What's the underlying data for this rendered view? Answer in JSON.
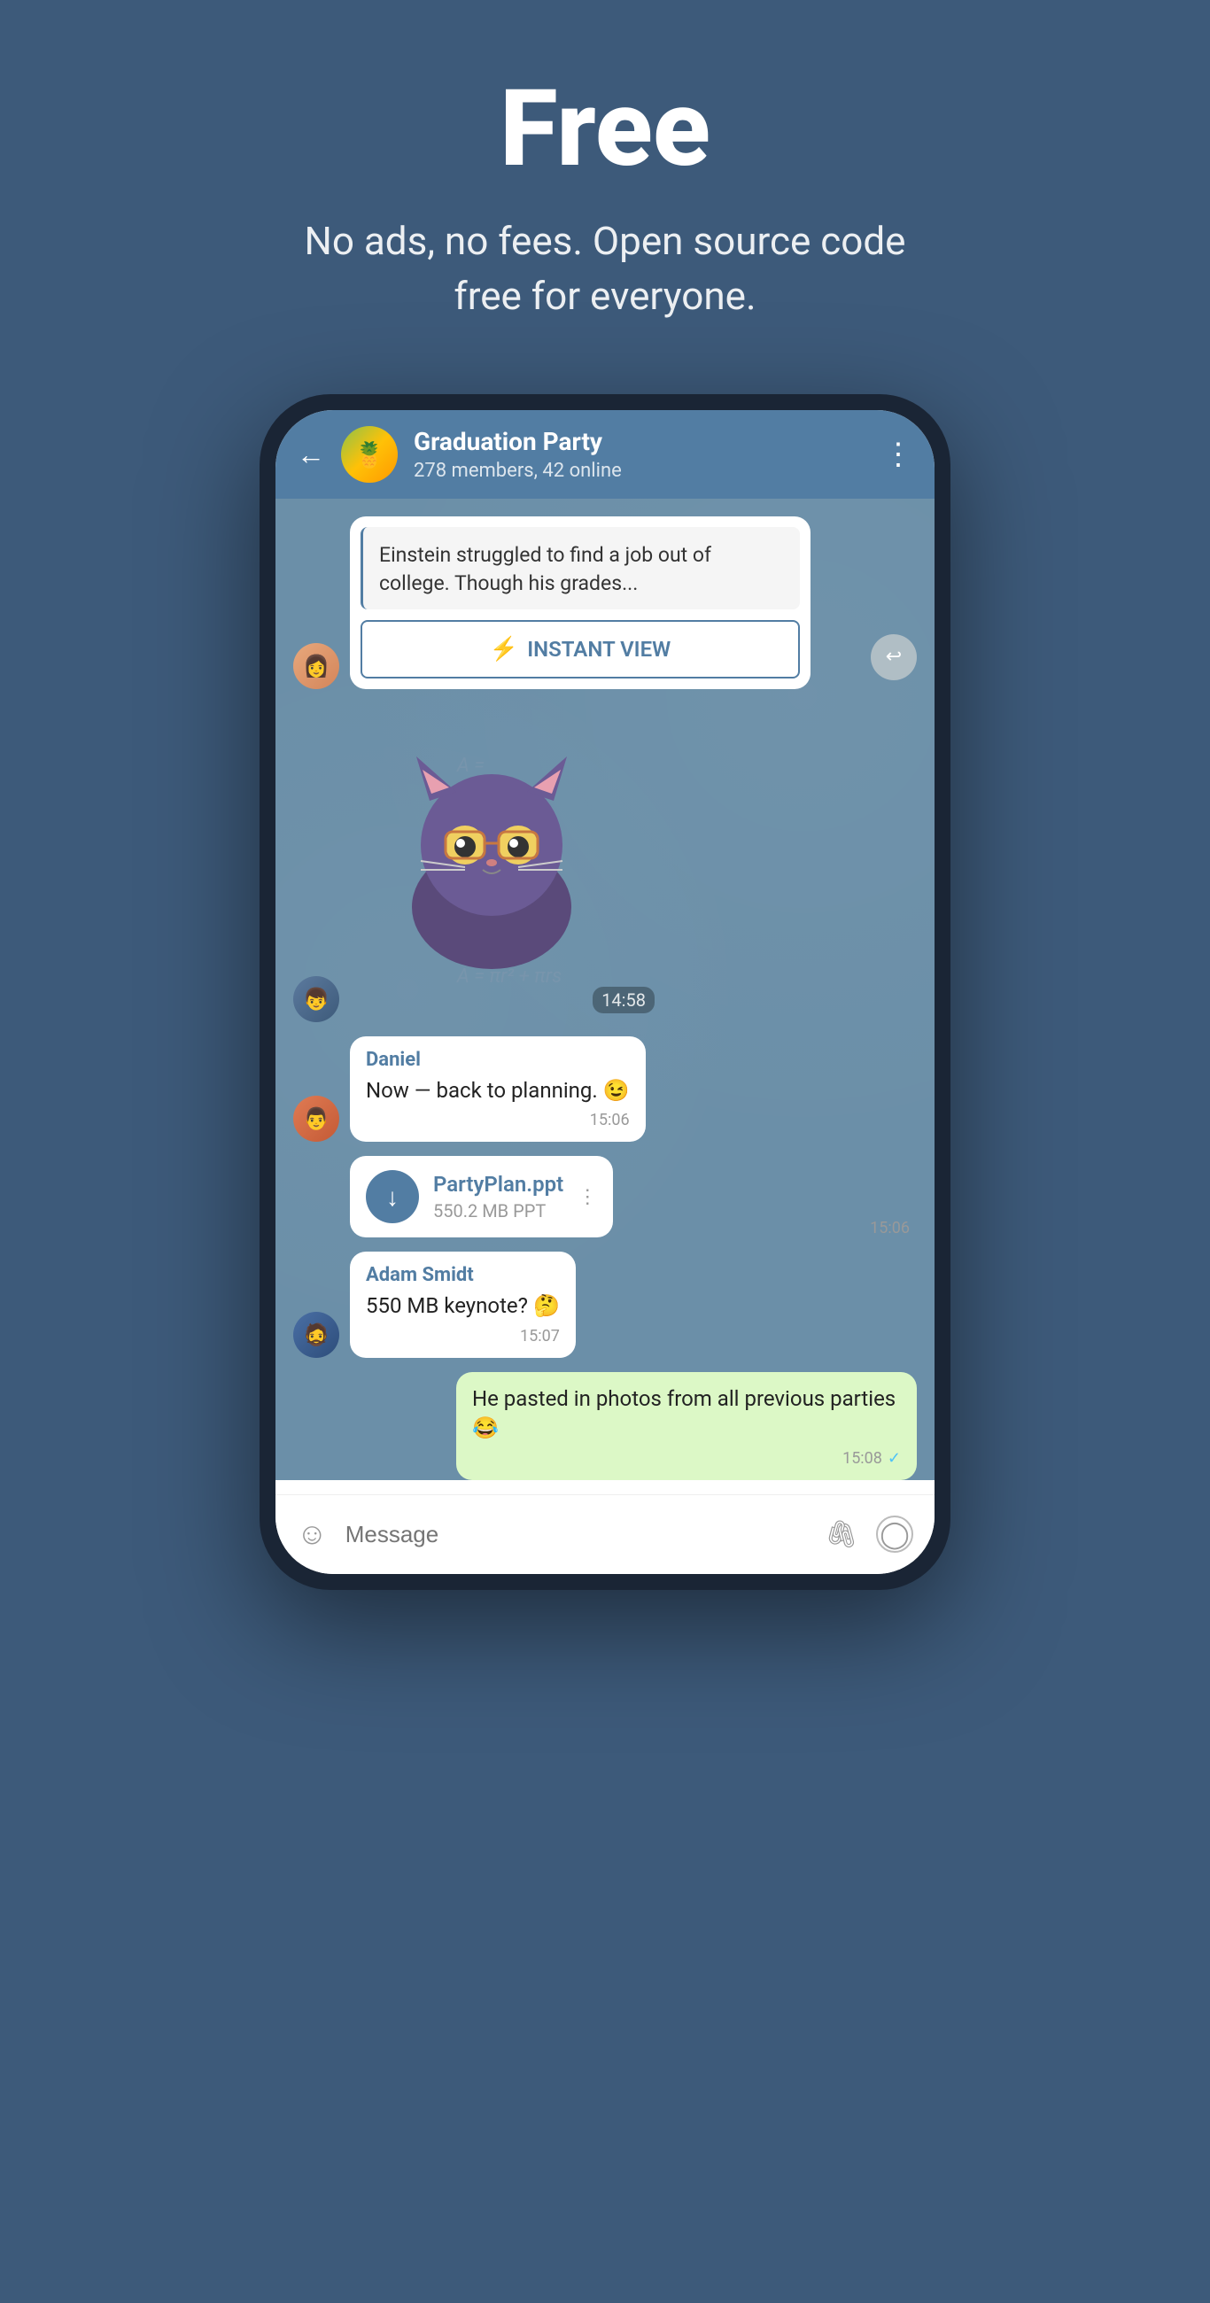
{
  "hero": {
    "title": "Free",
    "subtitle": "No ads, no fees. Open source code free for everyone."
  },
  "chat": {
    "header": {
      "back_label": "←",
      "group_name": "Graduation Party",
      "group_meta": "278 members, 42 online",
      "menu_icon": "⋮"
    },
    "article": {
      "text": "Einstein struggled to find a job out of college. Though his grades...",
      "instant_view_label": "INSTANT VIEW",
      "lightning": "⚡"
    },
    "sticker": {
      "time": "14:58"
    },
    "messages": [
      {
        "sender": "Daniel",
        "text": "Now — back to planning. 😉",
        "time": "15:06",
        "outgoing": false
      },
      {
        "file_name": "PartyPlan.ppt",
        "file_size": "550.2 MB PPT",
        "time": "15:06",
        "outgoing": false
      },
      {
        "sender": "Adam Smidt",
        "text": "550 MB keynote? 🤔",
        "time": "15:07",
        "outgoing": false
      },
      {
        "text": "He pasted in photos from all previous parties 😂",
        "time": "15:08",
        "outgoing": true,
        "checked": true
      }
    ],
    "input": {
      "placeholder": "Message",
      "emoji_icon": "☺",
      "attach_icon": "📎",
      "camera_icon": "◯"
    }
  }
}
